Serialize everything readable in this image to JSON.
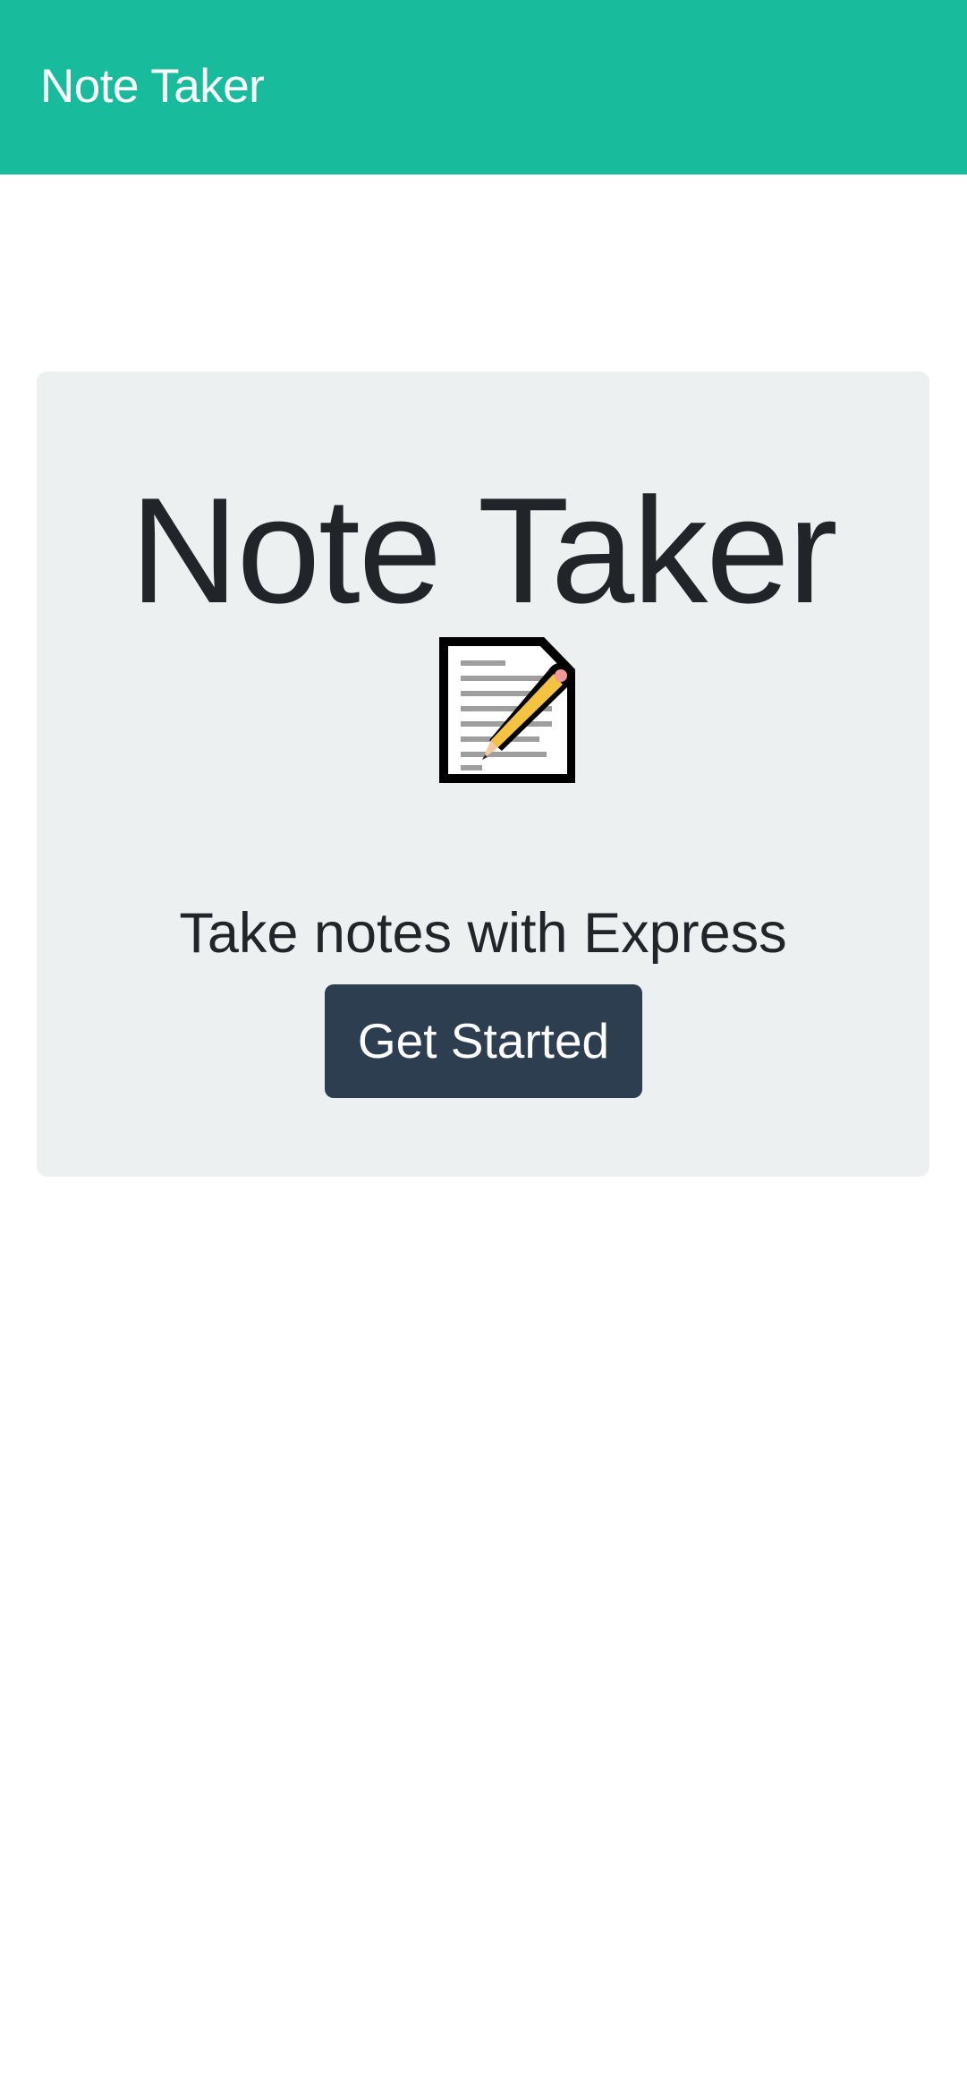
{
  "navbar": {
    "brand": "Note Taker",
    "background_color": "#18bc9c"
  },
  "hero": {
    "title": "Note Taker",
    "icon": "memo-icon",
    "lead": "Take notes with Express",
    "button_label": "Get Started",
    "background_color": "#ecf0f1",
    "button_color": "#2c3e50"
  }
}
